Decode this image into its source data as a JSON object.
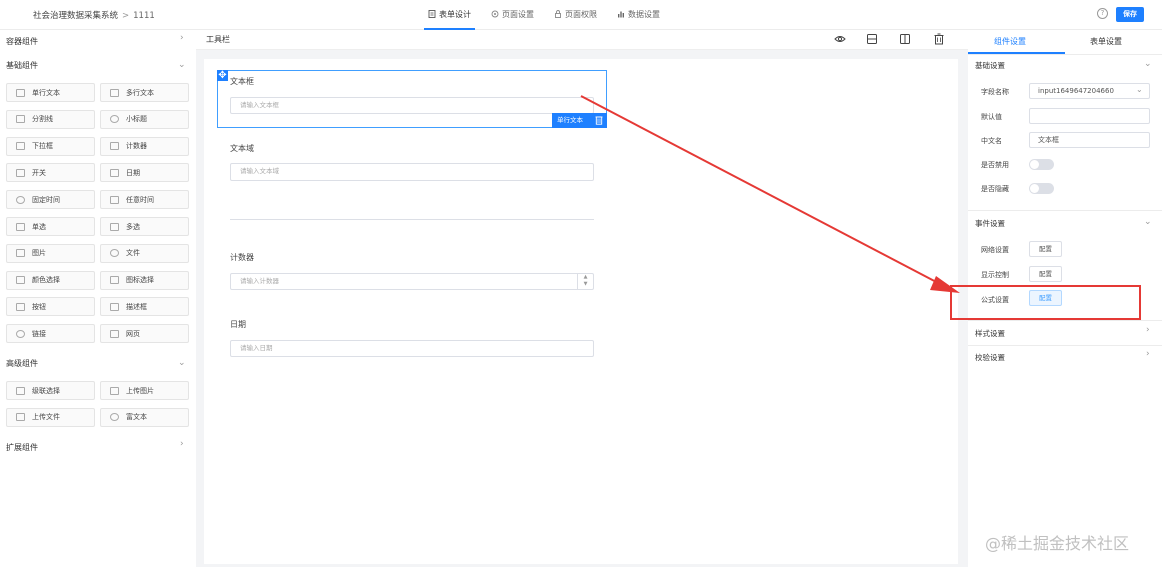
{
  "breadcrumb": {
    "root": "社会治理数据采集系统",
    "separator": ">",
    "current": "1111"
  },
  "top_tabs": [
    {
      "label": "表单设计",
      "icon": "form-icon",
      "active": true
    },
    {
      "label": "页面设置",
      "icon": "gear-icon",
      "active": false
    },
    {
      "label": "页面权限",
      "icon": "lock-icon",
      "active": false
    },
    {
      "label": "数据设置",
      "icon": "bar-chart-icon",
      "active": false
    }
  ],
  "help_icon": "?",
  "save_label": "保存",
  "accent_color": "#1e80ff",
  "left": {
    "container_title": "容器组件",
    "basic_title": "基础组件",
    "basic_items": [
      "单行文本",
      "多行文本",
      "分割线",
      "小标题",
      "下拉框",
      "计数器",
      "开关",
      "日期",
      "固定时间",
      "任意时间",
      "单选",
      "多选",
      "图片",
      "文件",
      "颜色选择",
      "图标选择",
      "按钮",
      "描述框",
      "链接",
      "网页"
    ],
    "advanced_title": "高级组件",
    "advanced_items": [
      "级联选择",
      "上传图片",
      "上传文件",
      "富文本"
    ],
    "extend_title": "扩展组件"
  },
  "toolbar": {
    "label": "工具栏",
    "icons": [
      "eye-icon",
      "layout-rows-icon",
      "layout-columns-icon",
      "trash-icon"
    ]
  },
  "canvas": {
    "fields": [
      {
        "label": "文本框",
        "placeholder": "请输入文本框"
      },
      {
        "label": "文本域",
        "placeholder": "请输入文本域"
      },
      {
        "label": "计数器",
        "placeholder": "请输入计数器"
      },
      {
        "label": "日期",
        "placeholder": "请输入日期"
      }
    ],
    "selected_tag": "单行文本"
  },
  "right": {
    "tabs": [
      "组件设置",
      "表单设置"
    ],
    "basic": {
      "title": "基础设置",
      "field_name_label": "字段名称",
      "field_name_value": "input1649647204660",
      "default_label": "默认值",
      "default_value": "",
      "cn_name_label": "中文名",
      "cn_name_value": "文本框",
      "disabled_label": "是否禁用",
      "disabled": false,
      "hidden_label": "是否隐藏",
      "hidden": false
    },
    "events": {
      "title": "事件设置",
      "network_label": "网络设置",
      "display_label": "显示控制",
      "formula_label": "公式设置",
      "config_label": "配置"
    },
    "style_title": "样式设置",
    "validation_title": "校验设置"
  },
  "watermark": "@稀土掘金技术社区"
}
